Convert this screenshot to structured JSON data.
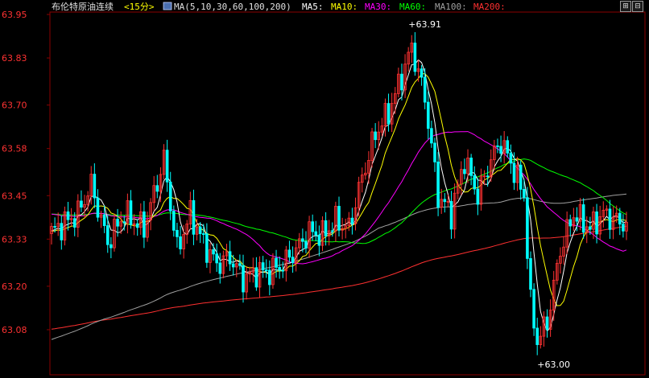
{
  "header": {
    "title": "布伦特原油连续",
    "period": "<15分>",
    "ma_params": "MA(5,10,30,60,100,200)",
    "ma_items": [
      {
        "label": "MA5:",
        "color": "#ffffff"
      },
      {
        "label": "MA10:",
        "color": "#ffff00"
      },
      {
        "label": "MA30:",
        "color": "#ff00ff"
      },
      {
        "label": "MA60:",
        "color": "#00ff00"
      },
      {
        "label": "MA100:",
        "color": "#a0a0a0"
      },
      {
        "label": "MA200:",
        "color": "#ff3030"
      }
    ]
  },
  "window_buttons": [
    "⊞",
    "⊟"
  ],
  "colors": {
    "background": "#000000",
    "frame": "#8b0000",
    "up_candle": "#ff3232",
    "down_candle": "#00ffff",
    "axis_label": "#ff3232"
  },
  "chart_data": {
    "type": "candlestick",
    "title": "布伦特原油连续",
    "ylim": [
      63.0,
      63.95
    ],
    "yticks": [
      "63.95",
      "63.83",
      "63.70",
      "63.58",
      "63.45",
      "63.33",
      "63.20",
      "63.08"
    ],
    "annotations": [
      {
        "text": "+63.91",
        "index": 109,
        "value": 63.91
      },
      {
        "text": "+63.00",
        "index": 148,
        "value": 63.0
      }
    ],
    "anchors": [
      [
        0,
        63.35
      ],
      [
        8,
        63.4
      ],
      [
        12,
        63.48
      ],
      [
        17,
        63.32
      ],
      [
        22,
        63.4
      ],
      [
        28,
        63.36
      ],
      [
        34,
        63.55
      ],
      [
        38,
        63.3
      ],
      [
        42,
        63.4
      ],
      [
        46,
        63.32
      ],
      [
        50,
        63.26
      ],
      [
        54,
        63.28
      ],
      [
        58,
        63.22
      ],
      [
        62,
        63.24
      ],
      [
        66,
        63.24
      ],
      [
        70,
        63.26
      ],
      [
        74,
        63.3
      ],
      [
        78,
        63.35
      ],
      [
        82,
        63.34
      ],
      [
        86,
        63.38
      ],
      [
        90,
        63.36
      ],
      [
        94,
        63.5
      ],
      [
        98,
        63.62
      ],
      [
        102,
        63.68
      ],
      [
        106,
        63.78
      ],
      [
        109,
        63.86
      ],
      [
        113,
        63.72
      ],
      [
        117,
        63.45
      ],
      [
        121,
        63.4
      ],
      [
        125,
        63.55
      ],
      [
        129,
        63.45
      ],
      [
        133,
        63.55
      ],
      [
        136,
        63.6
      ],
      [
        140,
        63.52
      ],
      [
        143,
        63.45
      ],
      [
        145,
        63.15
      ],
      [
        147,
        63.05
      ],
      [
        150,
        63.1
      ],
      [
        154,
        63.3
      ],
      [
        158,
        63.4
      ],
      [
        163,
        63.36
      ],
      [
        167,
        63.4
      ],
      [
        171,
        63.38
      ],
      [
        174,
        63.37
      ]
    ],
    "ma_right_values": {
      "MA60": 63.42,
      "MA100": 63.4,
      "MA200": 63.36,
      "MA30": 63.31
    }
  }
}
